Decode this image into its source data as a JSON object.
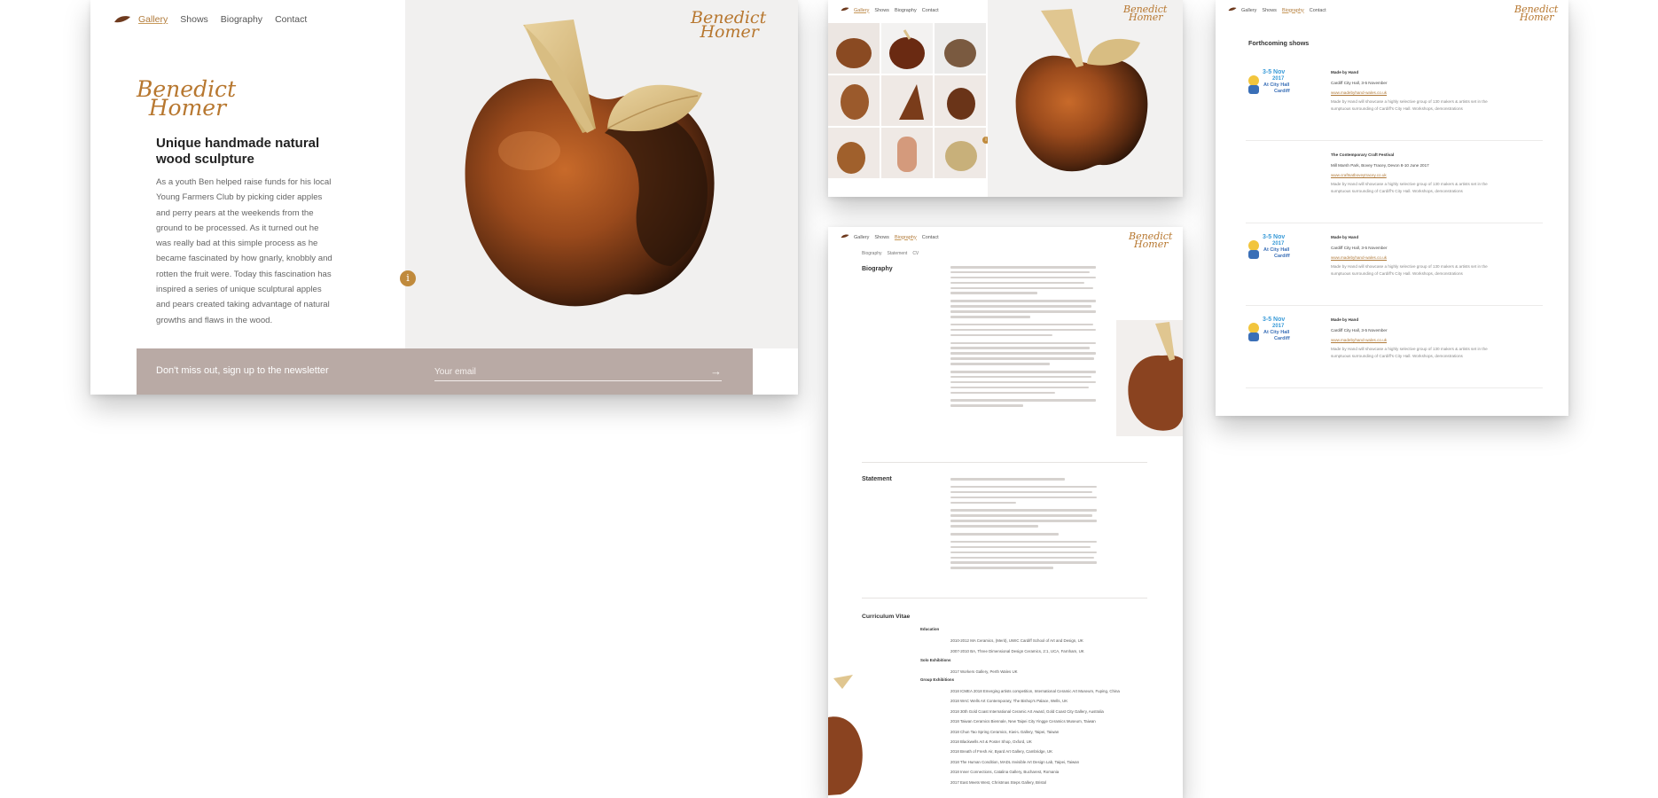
{
  "nav": {
    "gallery": "Gallery",
    "shows": "Shows",
    "biography": "Biography",
    "contact": "Contact"
  },
  "brand": {
    "line1": "Benedict",
    "line2": "Homer"
  },
  "hero": {
    "title_line1": "Unique handmade natural",
    "title_line2": "wood sculpture",
    "paragraph_lines": [
      "As a youth Ben helped raise funds for his local",
      "Young Farmers Club by picking cider apples",
      "and perry pears at the weekends from the",
      "ground to be processed. As it turned out he",
      "was really bad at this simple process as he",
      "became fascinated by how gnarly, knobbly and",
      "rotten the fruit were. Today this fascination has",
      "inspired a series of unique sculptural apples",
      "and pears created taking advantage of natural",
      "growths and flaws in the wood."
    ],
    "info_badge": "i"
  },
  "newsletter": {
    "label": "Don't miss out, sign up to the newsletter",
    "email_placeholder": "Your email",
    "arrow": "→"
  },
  "bio_page": {
    "subnav": [
      "Biography",
      "Statement",
      "CV"
    ],
    "biography_heading": "Biography",
    "statement_heading": "Statement",
    "cv_heading": "Curriculum Vitae",
    "education_label": "Education",
    "solo_label": "Solo Exhibitions",
    "group_label": "Group Exhibitions",
    "education_items": [
      "2010-2012  MA Ceramics, (Merit), UWIC Cardiff School of Art and Design, UK",
      "2007-2010  BA, Three Dimensional Design Ceramics, 2:1, UCA, Farnham, UK"
    ],
    "solo_items": [
      "2017  Workers Gallery, Perth Wales UK"
    ],
    "group_items": [
      "2018  ICMEA 2018 Emerging artists competition, International Ceramic Art Museum, Fuping, China",
      "2018  WAC Wells Art Contemporary, The Bishop's Palace, Wells, UK",
      "2018  30th Gold Coast International Ceramic Art Award, Gold Coast City Gallery, Australia",
      "2018  Taiwan Ceramics Biennale, New Taipei City Yingge Ceramics Museum, Taiwan",
      "2018  Chun Tao Spring Ceramics, Kiwi-L Gallery, Taipei, Taiwan",
      "2018  Blackwells Art & Poster Shop, Oxford, UK",
      "2018  Breath of Fresh Air, Byard Art Gallery, Cambridge, UK",
      "2018  The Human Condition, MADL Invisible Art Design Lab, Taipei, Taiwan",
      "2018  Inner Connections, Catalina Gallery, Bucharest, Romania",
      "2017  East Meets West, Christmas Steps Gallery, Bristol"
    ]
  },
  "shows_page": {
    "heading": "Forthcoming shows",
    "badge_dates": "3-5 Nov",
    "badge_year": "2017",
    "badge_venue1": "At City Hall",
    "badge_venue2": "Cardiff",
    "shows": [
      {
        "title": "Made by Hand",
        "venue": "Cardiff City Hall, 3-5 November",
        "link": "www.madebyhand-wales.co.uk",
        "desc1": "Made by Hand will showcase a highly selective group of 130 makers & artists set in the",
        "desc2": "sumptuous surrounding of Cardiff's City Hall. Workshops, demonstrations"
      },
      {
        "title": "The Contemporary Craft Festival",
        "venue": "Mill Marsh Park, Bovey Tracey, Devon 8-10 June 2017",
        "link": "www.craftsatboveytracey.co.uk",
        "desc1": "Made by Hand will showcase a highly selective group of 130 makers & artists set in the",
        "desc2": "sumptuous surrounding of Cardiff's City Hall. Workshops, demonstrations"
      },
      {
        "title": "Made by Hand",
        "venue": "Cardiff City Hall, 3-5 November",
        "link": "www.madebyhand-wales.co.uk",
        "desc1": "Made by Hand will showcase a highly selective group of 130 makers & artists set in the",
        "desc2": "sumptuous surrounding of Cardiff's City Hall. Workshops, demonstrations"
      },
      {
        "title": "Made by Hand",
        "venue": "Cardiff City Hall, 3-5 November",
        "link": "www.madebyhand-wales.co.uk",
        "desc1": "Made by Hand will showcase a highly selective group of 130 makers & artists set in the",
        "desc2": "sumptuous surrounding of Cardiff's City Hall. Workshops, demonstrations"
      }
    ]
  },
  "colors": {
    "accent": "#b7772f",
    "newsletter_bg": "#b9aaa5",
    "hero_bg": "#f1f0ef"
  }
}
